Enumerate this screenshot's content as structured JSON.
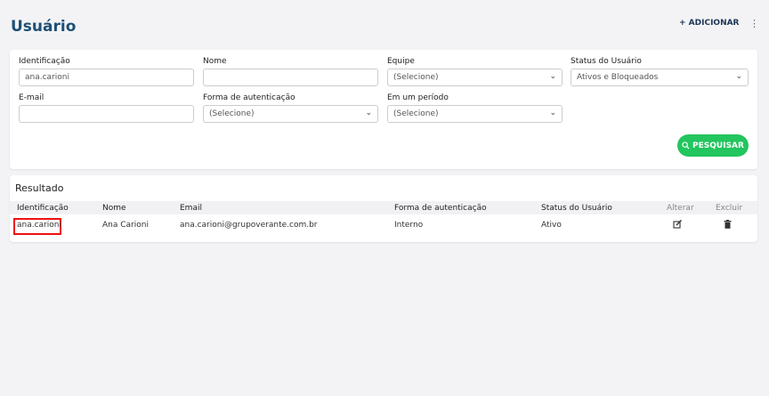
{
  "header": {
    "title": "Usuário",
    "add_label": "+ ADICIONAR",
    "more_icon": "⋮"
  },
  "filters": {
    "identificacao_label": "Identificação",
    "identificacao_value": "ana.carioni",
    "nome_label": "Nome",
    "nome_value": "",
    "equipe_label": "Equipe",
    "equipe_value": "(Selecione)",
    "status_label": "Status do Usuário",
    "status_value": "Ativos e Bloqueados",
    "email_label": "E-mail",
    "email_value": "",
    "auth_label": "Forma de autenticação",
    "auth_value": "(Selecione)",
    "periodo_label": "Em um período",
    "periodo_value": "(Selecione)",
    "search_label": "PESQUISAR"
  },
  "results": {
    "title": "Resultado",
    "columns": [
      "Identificação",
      "Nome",
      "Email",
      "Forma de autenticação",
      "Status do Usuário",
      "Alterar",
      "Excluir"
    ],
    "rows": [
      {
        "id": "ana.carioni",
        "nome": "Ana Carioni",
        "email": "ana.carioni@grupoverante.com.br",
        "auth": "Interno",
        "status": "Ativo"
      }
    ]
  }
}
